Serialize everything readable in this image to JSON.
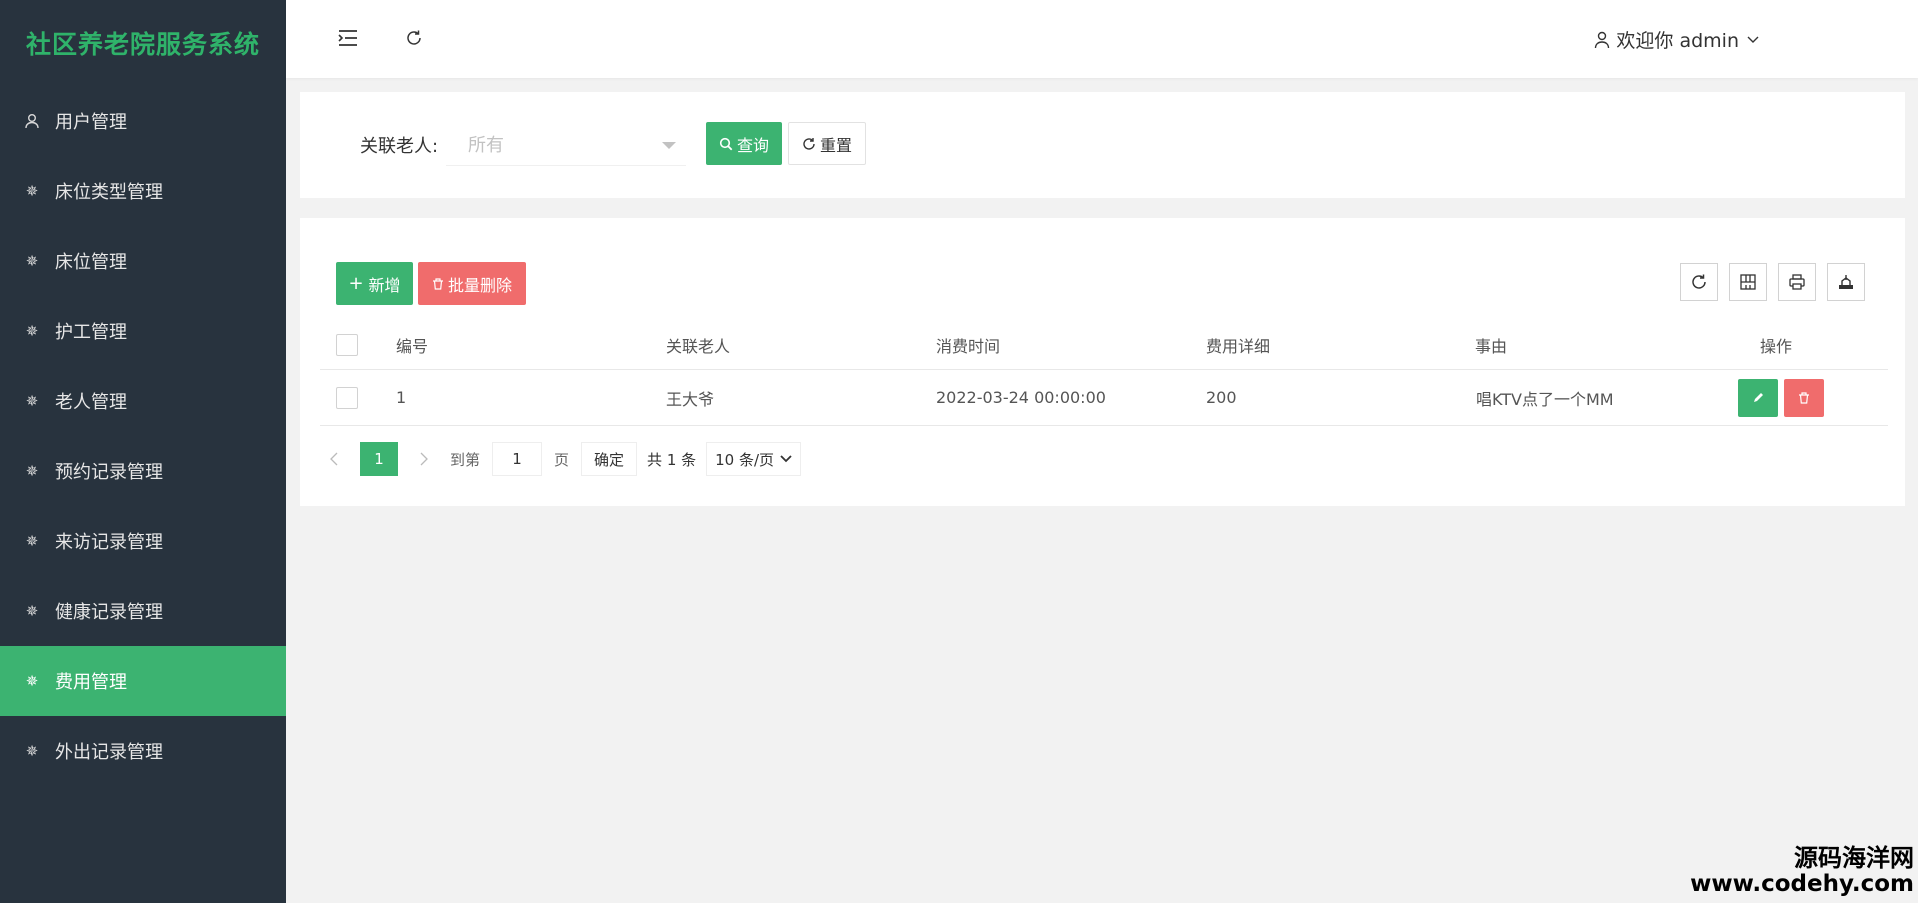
{
  "app": {
    "title": "社区养老院服务系统"
  },
  "sidebar": {
    "items": [
      {
        "label": "用户管理",
        "icon": "user-icon",
        "active": false
      },
      {
        "label": "床位类型管理",
        "icon": "gear-icon",
        "active": false
      },
      {
        "label": "床位管理",
        "icon": "gear-icon",
        "active": false
      },
      {
        "label": "护工管理",
        "icon": "gear-icon",
        "active": false
      },
      {
        "label": "老人管理",
        "icon": "gear-icon",
        "active": false
      },
      {
        "label": "预约记录管理",
        "icon": "gear-icon",
        "active": false
      },
      {
        "label": "来访记录管理",
        "icon": "gear-icon",
        "active": false
      },
      {
        "label": "健康记录管理",
        "icon": "gear-icon",
        "active": false
      },
      {
        "label": "费用管理",
        "icon": "gear-icon",
        "active": true
      },
      {
        "label": "外出记录管理",
        "icon": "gear-icon",
        "active": false
      }
    ]
  },
  "header": {
    "user_label": "欢迎你 admin"
  },
  "search": {
    "label": "关联老人:",
    "select_value": "所有",
    "query_label": "查询",
    "reset_label": "重置"
  },
  "toolbar": {
    "add_label": "新增",
    "batch_delete_label": "批量删除"
  },
  "table": {
    "columns": [
      "编号",
      "关联老人",
      "消费时间",
      "费用详细",
      "事由",
      "操作"
    ],
    "rows": [
      {
        "id": "1",
        "elder": "王大爷",
        "time": "2022-03-24 00:00:00",
        "detail": "200",
        "reason": "唱KTV点了一个MM"
      }
    ]
  },
  "pagination": {
    "current_page": "1",
    "goto_label": "到第",
    "goto_value": "1",
    "page_label": "页",
    "confirm_label": "确定",
    "total_label": "共 1 条",
    "page_size_label": "10 条/页"
  },
  "watermark": {
    "cn": "源码海洋网",
    "url": "www.codehy.com"
  },
  "colors": {
    "sidebar_bg": "#28333e",
    "accent_green": "#3cb371",
    "danger_red": "#f06c6c"
  }
}
